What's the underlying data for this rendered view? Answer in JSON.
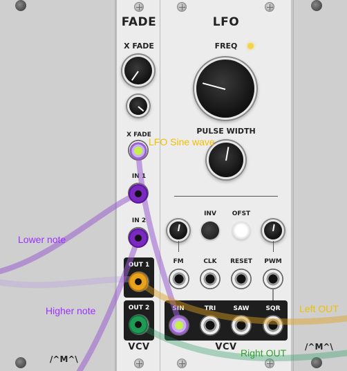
{
  "colors": {
    "rail": "#cfcfcf",
    "panel": "#ececec",
    "black_section": "#1e1e1e",
    "purple_cable": "#9b5fd0",
    "orange_cable": "#e0a020",
    "green_cable": "#2a9a60",
    "light_cable": "#b89de0",
    "led_yellow": "#f2d34a",
    "note_purple": "#9b30ff",
    "note_yellow": "#f0c000",
    "note_green": "#30a030"
  },
  "left_blank": {
    "logo": "/^M^\\"
  },
  "right_blank": {
    "logo": "/^M^\\"
  },
  "fade": {
    "title": "FADE",
    "xfade_label": "X FADE",
    "xfade_cv_label": "X FADE",
    "in1_label": "IN 1",
    "in2_label": "IN 2",
    "out1_label": "OUT 1",
    "out2_label": "OUT 2",
    "brand": "VCV"
  },
  "lfo": {
    "title": "LFO",
    "freq_label": "FREQ",
    "pulse_width_label": "PULSE WIDTH",
    "inv_label": "INV",
    "ofst_label": "OFST",
    "inputs": [
      "FM",
      "CLK",
      "RESET",
      "PWM"
    ],
    "outputs": [
      "SIN",
      "TRI",
      "SAW",
      "SQR"
    ],
    "brand": "VCV"
  },
  "annotations": {
    "lfo_sine": "LFO Sine wave",
    "lower_note": "Lower note",
    "higher_note": "Higher note",
    "left_out": "Left OUT",
    "right_out": "Right OUT"
  }
}
